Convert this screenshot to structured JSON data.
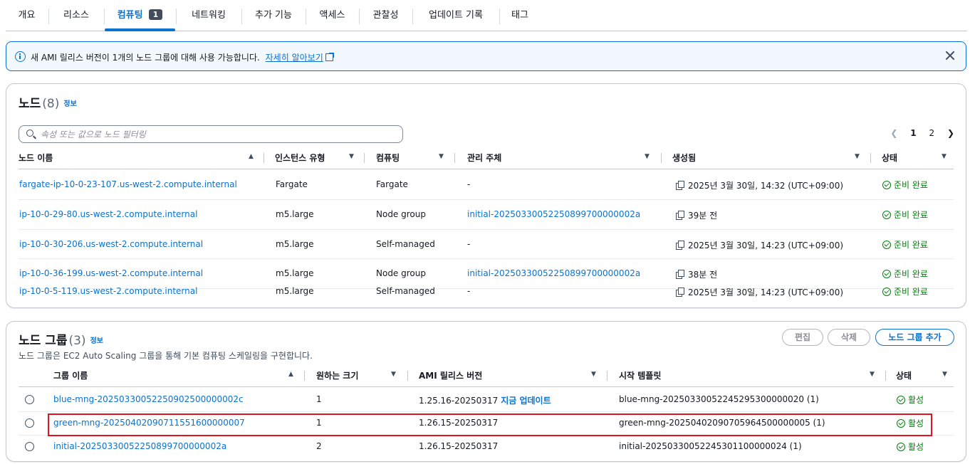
{
  "tabs": [
    {
      "label": "개요"
    },
    {
      "label": "리소스"
    },
    {
      "label": "컴퓨팅",
      "badge": "1",
      "active": true
    },
    {
      "label": "네트워킹"
    },
    {
      "label": "추가 기능"
    },
    {
      "label": "액세스"
    },
    {
      "label": "관찰성"
    },
    {
      "label": "업데이트 기록"
    },
    {
      "label": "태그"
    }
  ],
  "flash": {
    "message": "새 AMI 릴리스 버전이 1개의 노드 그룹에 대해 사용 가능합니다.",
    "link": "자세히 알아보기",
    "icon": "info-icon",
    "color": "#0972d3"
  },
  "nodes": {
    "title": "노드",
    "count": "(8)",
    "info": "정보",
    "search_placeholder": "속성 또는 값으로 노드 필터링",
    "pages": [
      "1",
      "2"
    ],
    "current_page": "1",
    "columns": [
      "노드 이름",
      "인스턴스 유형",
      "컴퓨팅",
      "관리 주체",
      "생성됨",
      "상태"
    ],
    "rows": [
      {
        "name": "fargate-ip-10-0-23-107.us-west-2.compute.internal",
        "type": "Fargate",
        "compute": "Fargate",
        "managed_by": "-",
        "created": "2025년 3월 30일, 14:32 (UTC+09:00)",
        "status": "준비 완료"
      },
      {
        "name": "ip-10-0-29-80.us-west-2.compute.internal",
        "type": "m5.large",
        "compute": "Node group",
        "managed_by": "initial-20250330052250899700000002a",
        "created": "39분 전",
        "status": "준비 완료"
      },
      {
        "name": "ip-10-0-30-206.us-west-2.compute.internal",
        "type": "m5.large",
        "compute": "Self-managed",
        "managed_by": "-",
        "created": "2025년 3월 30일, 14:23 (UTC+09:00)",
        "status": "준비 완료"
      },
      {
        "name": "ip-10-0-36-199.us-west-2.compute.internal",
        "type": "m5.large",
        "compute": "Node group",
        "managed_by": "initial-20250330052250899700000002a",
        "created": "38분 전",
        "status": "준비 완료"
      },
      {
        "name": "ip-10-0-5-119.us-west-2.compute.internal",
        "type": "m5.large",
        "compute": "Self-managed",
        "managed_by": "-",
        "created": "2025년 3월 30일, 14:23 (UTC+09:00)",
        "status": "준비 완료"
      }
    ]
  },
  "node_groups": {
    "title": "노드 그룹",
    "count": "(3)",
    "info": "정보",
    "subtitle": "노드 그룹은 EC2 Auto Scaling 그룹을 통해 기본 컴퓨팅 스케일링을 구현합니다.",
    "buttons": {
      "edit": "편집",
      "delete": "삭제",
      "add": "노드 그룹 추가"
    },
    "columns": [
      "그룹 이름",
      "원하는 크기",
      "AMI 릴리스 버전",
      "시작 템플릿",
      "상태"
    ],
    "rows": [
      {
        "name": "blue-mng-20250330052250902500000002c",
        "desired": "1",
        "ami": "1.25.16-20250317",
        "update": "지금 업데이트",
        "template": "blue-mng-20250330052245295300000020 (1)",
        "status": "활성"
      },
      {
        "name": "green-mng-20250402090711551600000007",
        "desired": "1",
        "ami": "1.26.15-20250317",
        "update": "",
        "template": "green-mng-20250402090705964500000005 (1)",
        "status": "활성",
        "highlighted": true
      },
      {
        "name": "initial-20250330052250899700000002a",
        "desired": "2",
        "ami": "1.26.15-20250317",
        "update": "",
        "template": "initial-20250330052245301100000024 (1)",
        "status": "활성"
      }
    ]
  },
  "colors": {
    "accent": "#0972d3",
    "success": "#037f0c",
    "highlight": "#e0141e"
  }
}
